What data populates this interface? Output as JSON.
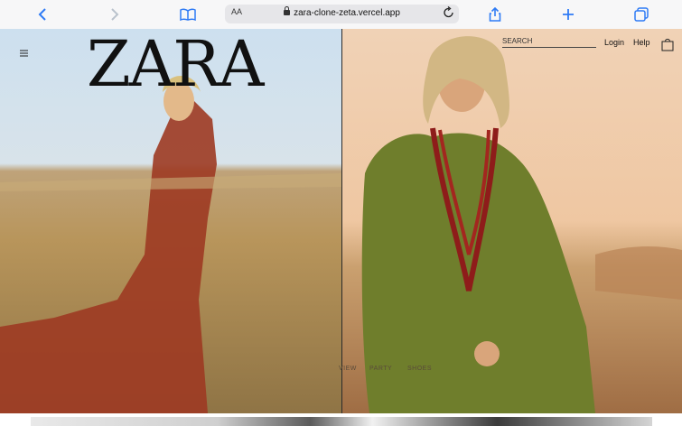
{
  "browser": {
    "text_size": "AA",
    "url": "zara-clone-zeta.vercel.app"
  },
  "site": {
    "logo": "ZARA",
    "search_placeholder": "SEARCH",
    "login": "Login",
    "help": "Help"
  },
  "hero_nav": [
    "VIEW",
    "PARTY",
    "SHOES"
  ],
  "colors": {
    "toolbar_icon": "#2f7bf5",
    "toolbar_bg": "#f7f7f8"
  },
  "icons": [
    "back-icon",
    "forward-icon",
    "book-icon",
    "lock-icon",
    "reload-icon",
    "share-icon",
    "plus-icon",
    "tabs-icon",
    "menu-icon",
    "bag-icon"
  ]
}
